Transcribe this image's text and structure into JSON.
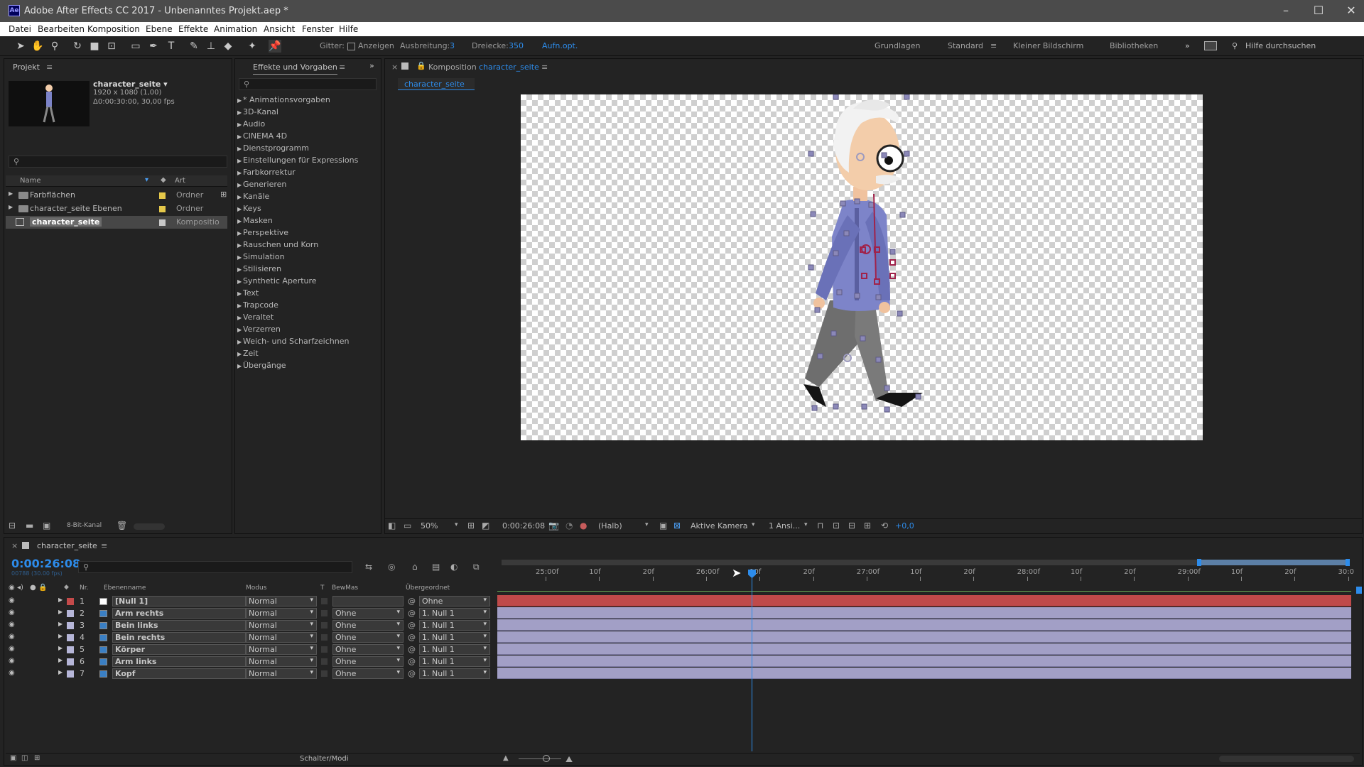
{
  "window": {
    "title": "Adobe After Effects CC 2017 - Unbenanntes Projekt.aep *",
    "logo": "Ae"
  },
  "menu": [
    "Datei",
    "Bearbeiten",
    "Komposition",
    "Ebene",
    "Effekte",
    "Animation",
    "Ansicht",
    "Fenster",
    "Hilfe"
  ],
  "toolbar": {
    "grid_label": "Gitter:",
    "show_label": "Anzeigen",
    "spread_label": "Ausbreitung:",
    "spread_value": "3",
    "triangles_label": "Dreiecke:",
    "triangles_value": "350",
    "record_label": "Aufn.opt.",
    "workspaces": [
      "Grundlagen",
      "Standard",
      "Kleiner Bildschirm",
      "Bibliotheken"
    ],
    "search_placeholder": "Hilfe durchsuchen"
  },
  "project": {
    "tab": "Projekt",
    "comp_name": "character_seite ▾",
    "comp_size": "1920 x 1080 (1,00)",
    "comp_duration": "Δ0:00:30:00, 30,00 fps",
    "col_name": "Name",
    "col_type": "Art",
    "items": [
      {
        "name": "Farbflächen",
        "type": "Ordner",
        "color": "#e5c84a"
      },
      {
        "name": "character_seite Ebenen",
        "type": "Ordner",
        "color": "#e5c84a"
      },
      {
        "name": "character_seite",
        "type": "Kompositio",
        "color": "#c8c8c8"
      }
    ],
    "footer_bpc": "8-Bit-Kanal"
  },
  "effects": {
    "tab": "Effekte und Vorgaben",
    "items": [
      "* Animationsvorgaben",
      "3D-Kanal",
      "Audio",
      "CINEMA 4D",
      "Dienstprogramm",
      "Einstellungen für Expressions",
      "Farbkorrektur",
      "Generieren",
      "Kanäle",
      "Keys",
      "Masken",
      "Perspektive",
      "Rauschen und Korn",
      "Simulation",
      "Stilisieren",
      "Synthetic Aperture",
      "Text",
      "Trapcode",
      "Veraltet",
      "Verzerren",
      "Weich- und Scharfzeichnen",
      "Zeit",
      "Übergänge"
    ]
  },
  "composition": {
    "tab_prefix": "Komposition",
    "tab_name": "character_seite",
    "subtab": "character_seite",
    "footer": {
      "zoom": "50%",
      "timecode": "0:00:26:08",
      "resolution": "(Halb)",
      "camera": "Aktive Kamera",
      "views": "1 Ansi...",
      "exposure": "+0,0"
    }
  },
  "timeline": {
    "tab": "character_seite",
    "timecode": "0:00:26:08",
    "frame_info": "00788 (30.00 fps)",
    "cols": {
      "nr": "Nr.",
      "name": "Ebenenname",
      "mode": "Modus",
      "t": "T",
      "trkmat": "BewMas",
      "parent": "Übergeordnet"
    },
    "layers": [
      {
        "nr": "1",
        "name": "[Null 1]",
        "mode": "Normal",
        "trkmat": "",
        "parent": "Ohne",
        "color": "#c44a4a"
      },
      {
        "nr": "2",
        "name": "Arm rechts",
        "mode": "Normal",
        "trkmat": "Ohne",
        "parent": "1. Null 1",
        "color": "#b6b6d8"
      },
      {
        "nr": "3",
        "name": "Bein links",
        "mode": "Normal",
        "trkmat": "Ohne",
        "parent": "1. Null 1",
        "color": "#b6b6d8"
      },
      {
        "nr": "4",
        "name": "Bein rechts",
        "mode": "Normal",
        "trkmat": "Ohne",
        "parent": "1. Null 1",
        "color": "#b6b6d8"
      },
      {
        "nr": "5",
        "name": "Körper",
        "mode": "Normal",
        "trkmat": "Ohne",
        "parent": "1. Null 1",
        "color": "#b6b6d8"
      },
      {
        "nr": "6",
        "name": "Arm links",
        "mode": "Normal",
        "trkmat": "Ohne",
        "parent": "1. Null 1",
        "color": "#b6b6d8"
      },
      {
        "nr": "7",
        "name": "Kopf",
        "mode": "Normal",
        "trkmat": "Ohne",
        "parent": "1. Null 1",
        "color": "#b6b6d8"
      }
    ],
    "ruler": [
      "25:00f",
      "10f",
      "20f",
      "26:00f",
      "10f",
      "20f",
      "27:00f",
      "10f",
      "20f",
      "28:00f",
      "10f",
      "20f",
      "29:00f",
      "10f",
      "20f",
      "30:0"
    ],
    "footer_label": "Schalter/Modi"
  }
}
